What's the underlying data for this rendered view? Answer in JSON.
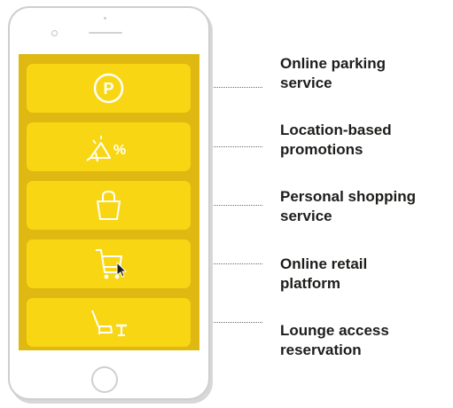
{
  "colors": {
    "screen": "#dfb911",
    "tile": "#f9d613",
    "icon": "#ffffff",
    "label_text": "#1d1d1b",
    "phone_outline": "#cfcfcf"
  },
  "services": [
    {
      "icon": "parking-icon",
      "label": "Online parking\nservice"
    },
    {
      "icon": "promotion-megaphone-icon",
      "label": "Location-based\npromotions"
    },
    {
      "icon": "shopping-bag-icon",
      "label": "Personal shopping\nservice"
    },
    {
      "icon": "shopping-cart-icon",
      "label": "Online retail\nplatform"
    },
    {
      "icon": "lounge-chair-icon",
      "label": "Lounge access\nreservation"
    }
  ],
  "icon_text": {
    "parking": "P",
    "percent": "%"
  }
}
